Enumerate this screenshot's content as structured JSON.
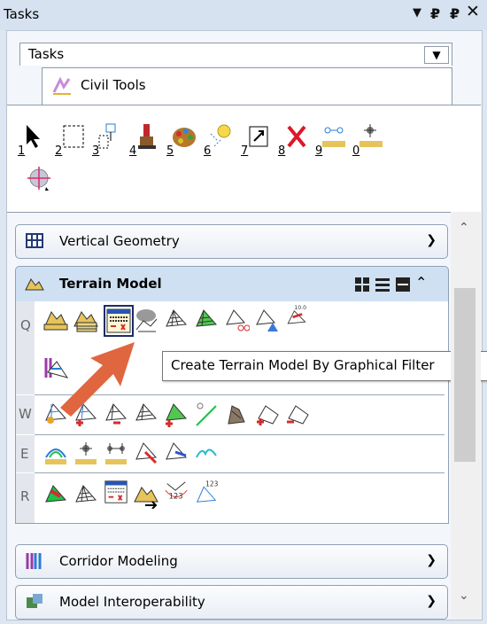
{
  "window": {
    "title": "Tasks"
  },
  "task_combo": {
    "value": "Tasks"
  },
  "task_group": {
    "label": "Civil Tools"
  },
  "toolbox": {
    "numbers": [
      "1",
      "2",
      "3",
      "4",
      "5",
      "6",
      "7",
      "8",
      "9",
      "0"
    ]
  },
  "sections": {
    "vertical_geometry": "Vertical Geometry",
    "terrain_model": "Terrain Model",
    "corridor_modeling": "Corridor Modeling",
    "model_interoperability": "Model Interoperability"
  },
  "terrain_rows": [
    "Q",
    "W",
    "E",
    "R"
  ],
  "tooltip": "Create Terrain Model By Graphical Filter",
  "badges": {
    "ten": "10.0",
    "num123a": "123",
    "num123b": "123"
  },
  "colors": {
    "arrow": "#e0663f",
    "header": "#cfe0f2",
    "highlight": "#1c2d66"
  }
}
